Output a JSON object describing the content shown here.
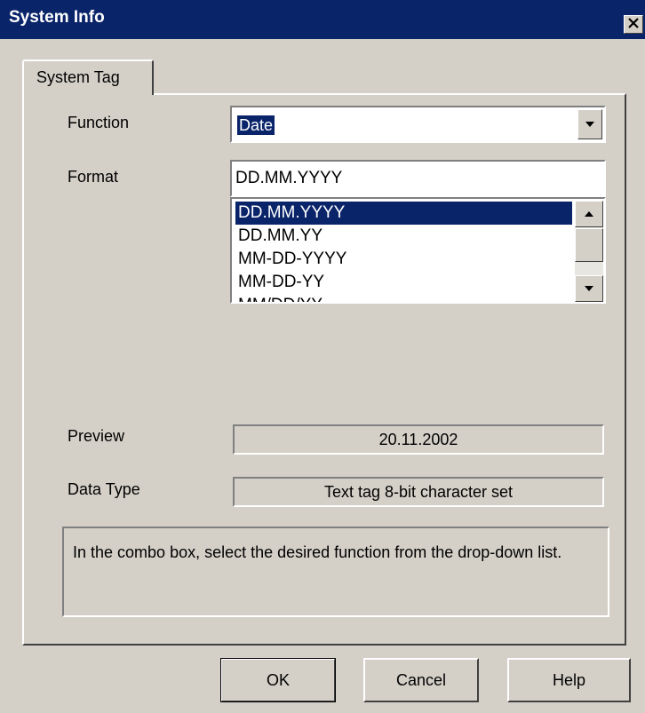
{
  "window": {
    "title": "System Info",
    "close_icon": "close-icon"
  },
  "tabs": [
    {
      "label": "System Tag",
      "active": true
    }
  ],
  "function_field": {
    "label": "Function",
    "value": "Date",
    "arrow_icon": "chevron-down-icon"
  },
  "format_field": {
    "label": "Format",
    "value": "DD.MM.YYYY",
    "options": [
      "DD.MM.YYYY",
      "DD.MM.YY",
      "MM-DD-YYYY",
      "MM-DD-YY",
      "MM/DD/YY"
    ],
    "selected_index": 0
  },
  "preview": {
    "label": "Preview",
    "value": "20.11.2002"
  },
  "data_type": {
    "label": "Data Type",
    "value": "Text tag 8-bit character set"
  },
  "help_text": "In the combo box, select the desired function from the drop-down list.",
  "buttons": {
    "ok": "OK",
    "cancel": "Cancel",
    "help": "Help"
  },
  "colors": {
    "titlebar": "#0a246a",
    "selection": "#0a246a",
    "face": "#d4d0c8"
  }
}
